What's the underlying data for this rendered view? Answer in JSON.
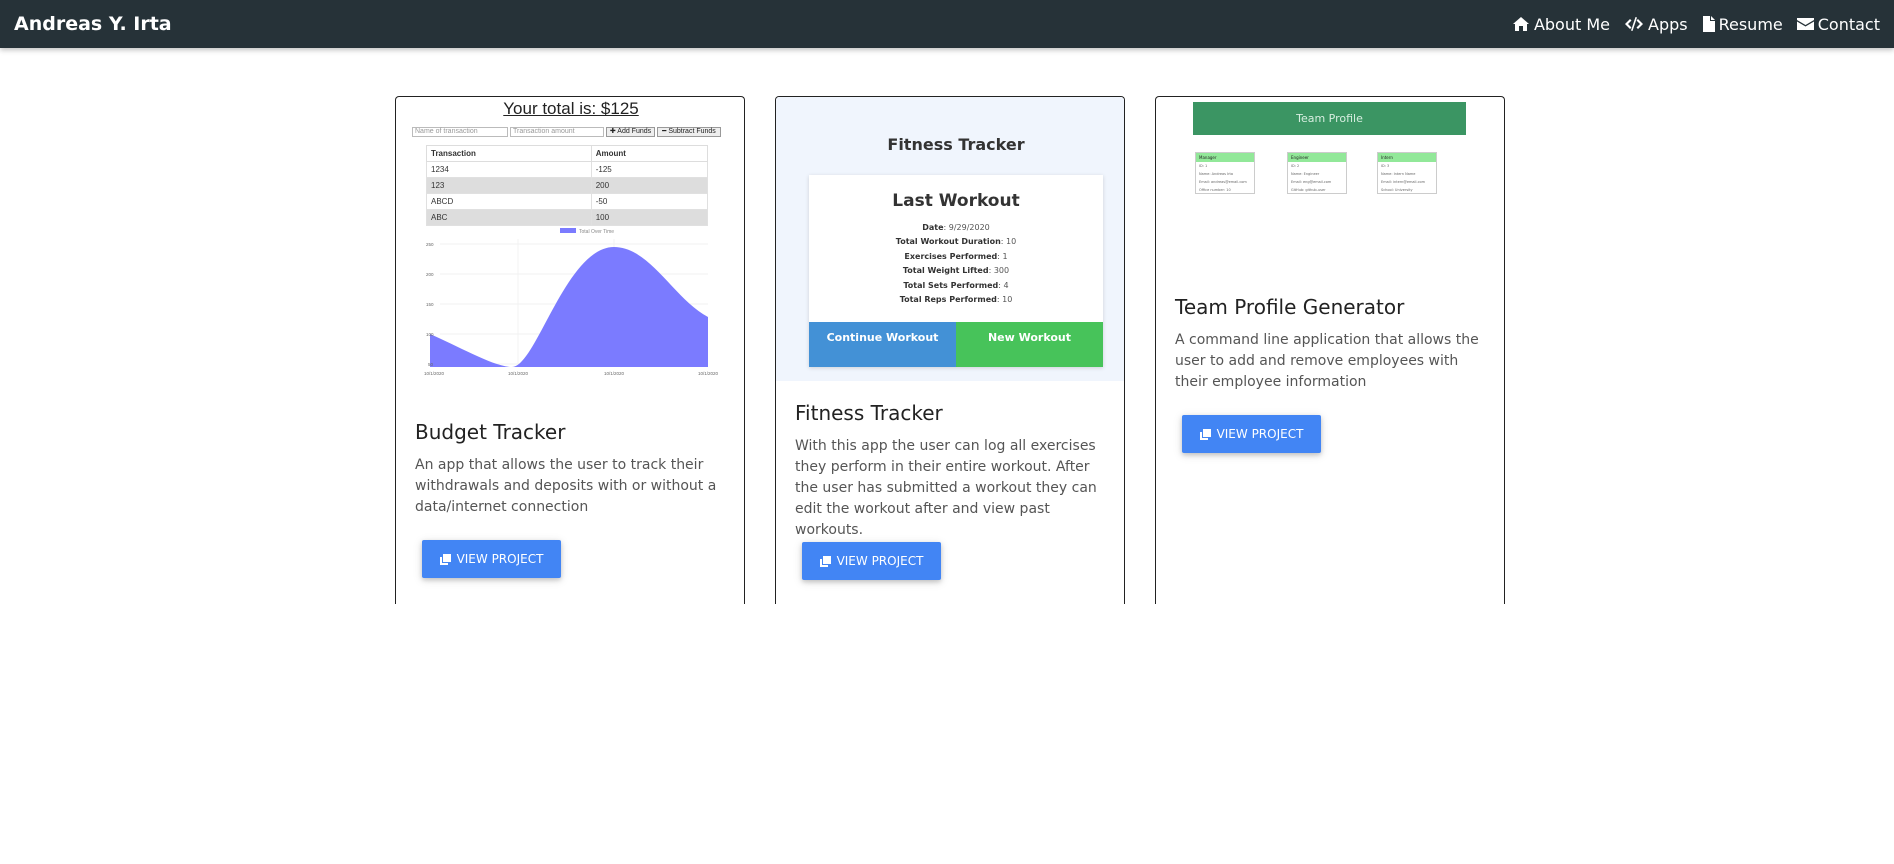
{
  "navbar": {
    "brand": "Andreas Y. Irta",
    "links": [
      {
        "label": "About Me",
        "icon": "home-icon"
      },
      {
        "label": "Apps",
        "icon": "code-icon"
      },
      {
        "label": "Resume",
        "icon": "file-icon"
      },
      {
        "label": "Contact",
        "icon": "envelope-icon"
      }
    ]
  },
  "projects": [
    {
      "title": "Budget Tracker",
      "description": "An app that allows the user to track their withdrawals and deposits with or without a data/internet connection",
      "button": "View Project"
    },
    {
      "title": "Fitness Tracker",
      "description": "With this app the user can log all exercises they perform in their entire workout. After the user has submitted a workout they can edit the workout after and view past workouts.",
      "button": "View Project"
    },
    {
      "title": "Team Profile Generator",
      "description": "A command line application that allows the user to add and remove employees with their employee information",
      "button": "View Project"
    }
  ],
  "budget_preview": {
    "total": "Your total is: $125",
    "name_placeholder": "Name of transaction",
    "amount_placeholder": "Transaction amount",
    "add_label": "✚ Add Funds",
    "subtract_label": "━ Subtract Funds",
    "headers": [
      "Transaction",
      "Amount"
    ],
    "rows": [
      [
        "1234",
        "-125"
      ],
      [
        "123",
        "200"
      ],
      [
        "ABCD",
        "-50"
      ],
      [
        "ABC",
        "100"
      ]
    ],
    "chart_legend": "Total Over Time",
    "chart_y_ticks": [
      "250",
      "200",
      "150",
      "100",
      "50"
    ],
    "chart_x_ticks": [
      "10/1/2020",
      "10/1/2020",
      "10/1/2020",
      "10/1/2020"
    ],
    "chart_color": "#7b7bff"
  },
  "fitness_preview": {
    "heading": "Fitness Tracker",
    "last_workout": "Last Workout",
    "stats": [
      {
        "label": "Date",
        "value": "9/29/2020"
      },
      {
        "label": "Total Workout Duration",
        "value": "10"
      },
      {
        "label": "Exercises Performed",
        "value": "1"
      },
      {
        "label": "Total Weight Lifted",
        "value": "300"
      },
      {
        "label": "Total Sets Performed",
        "value": "4"
      },
      {
        "label": "Total Reps Performed",
        "value": "10"
      }
    ],
    "continue_label": "Continue Workout",
    "new_label": "New Workout"
  },
  "team_preview": {
    "banner": "Team Profile",
    "cards": [
      {
        "role": "Manager",
        "lines": [
          "ID: 1",
          "Name: Andreas Irta",
          "Email: andreas@email.com",
          "Office number: 10"
        ]
      },
      {
        "role": "Engineer",
        "lines": [
          "ID: 2",
          "Name: Engineer",
          "Email: eng@email.com",
          "GitHub: github-user"
        ]
      },
      {
        "role": "Intern",
        "lines": [
          "ID: 3",
          "Name: Intern Name",
          "Email: intern@email.com",
          "School: University"
        ]
      }
    ]
  },
  "colors": {
    "navbar": "#263238",
    "button": "#4285f4",
    "fitness_continue": "#4391d6",
    "fitness_new": "#47c35a",
    "team_banner": "#3b9563"
  }
}
